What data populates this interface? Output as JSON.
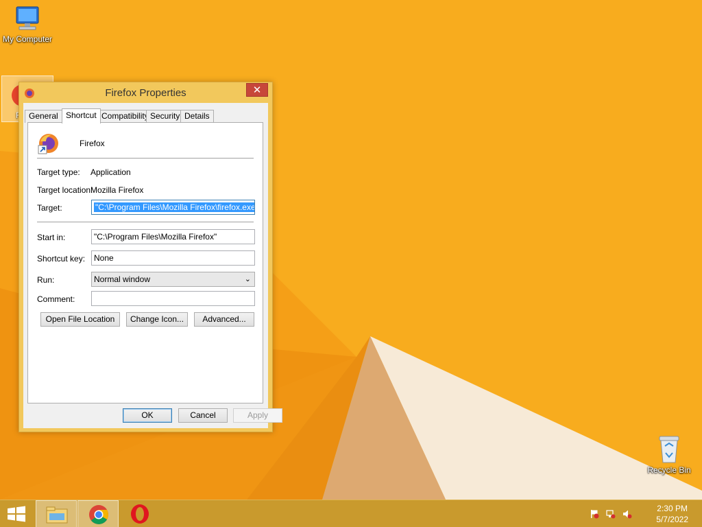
{
  "desktop": {
    "icons": {
      "my_computer": "My Computer",
      "recycle_bin": "Recycle Bin",
      "firefox_partial": "F"
    }
  },
  "dialog": {
    "title": "Firefox Properties",
    "close_glyph": "✕",
    "tabs": [
      "General",
      "Shortcut",
      "Compatibility",
      "Security",
      "Details"
    ],
    "active_tab": "Shortcut",
    "app_name": "Firefox",
    "target_type_label": "Target type:",
    "target_type_value": "Application",
    "target_location_label": "Target location:",
    "target_location_value": "Mozilla Firefox",
    "target_label": "Target:",
    "target_value": "\"C:\\Program Files\\Mozilla Firefox\\firefox.exe\"",
    "start_in_label": "Start in:",
    "start_in_value": "\"C:\\Program Files\\Mozilla Firefox\"",
    "shortcut_key_label": "Shortcut key:",
    "shortcut_key_value": "None",
    "run_label": "Run:",
    "run_value": "Normal window",
    "comment_label": "Comment:",
    "comment_value": "",
    "open_file_location_label": "Open File Location",
    "change_icon_label": "Change Icon...",
    "advanced_label": "Advanced...",
    "ok_label": "OK",
    "cancel_label": "Cancel",
    "apply_label": "Apply"
  },
  "taskbar": {
    "apps": [
      "file-explorer-icon",
      "chrome-icon",
      "opera-icon"
    ],
    "clock_time": "2:30 PM",
    "clock_date": "5/7/2022"
  },
  "colors": {
    "wallpaper": "#f7a51c",
    "dialog_frame": "#f2c85c",
    "close_button": "#c7473a",
    "taskbar": "#c99a2d",
    "selection": "#3399ff"
  }
}
